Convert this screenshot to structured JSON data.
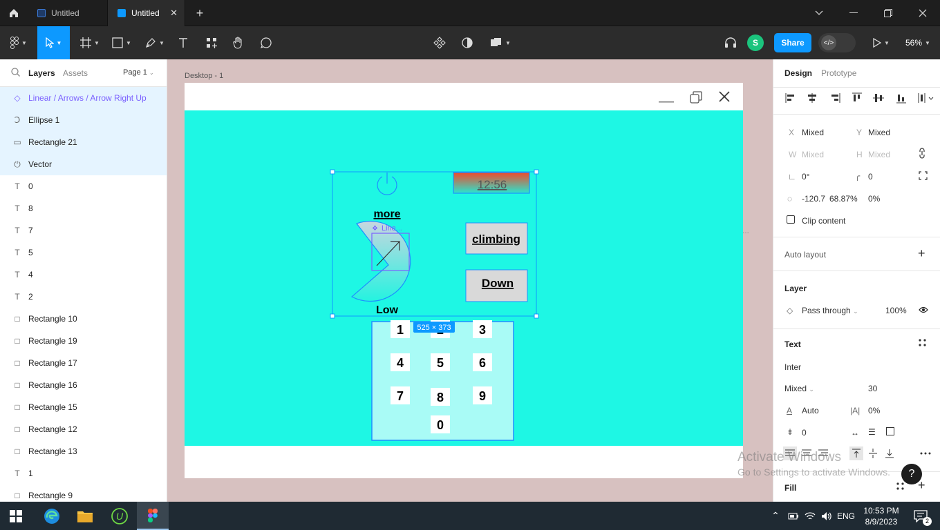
{
  "tabs": [
    {
      "label": "Untitled",
      "active": false
    },
    {
      "label": "Untitled",
      "active": true
    }
  ],
  "toolbar": {
    "share_label": "Share",
    "avatar_initial": "S",
    "zoom": "56%"
  },
  "left_panel": {
    "tab_layers": "Layers",
    "tab_assets": "Assets",
    "page": "Page 1",
    "layers": [
      {
        "icon": "component-icon",
        "glyph": "◇",
        "label": "Linear / Arrows / Arrow Right Up",
        "selected": true,
        "component": true
      },
      {
        "icon": "ellipse-icon",
        "glyph": "Ↄ",
        "label": "Ellipse 1",
        "selected": true,
        "component": false
      },
      {
        "icon": "rectangle-icon",
        "glyph": "▭",
        "label": "Rectangle 21",
        "selected": true,
        "component": false
      },
      {
        "icon": "vector-icon",
        "glyph": "⏻",
        "label": "Vector",
        "selected": true,
        "component": false
      },
      {
        "icon": "text-icon",
        "glyph": "T",
        "label": "0",
        "selected": false,
        "component": false
      },
      {
        "icon": "text-icon",
        "glyph": "T",
        "label": "8",
        "selected": false,
        "component": false
      },
      {
        "icon": "text-icon",
        "glyph": "T",
        "label": "7",
        "selected": false,
        "component": false
      },
      {
        "icon": "text-icon",
        "glyph": "T",
        "label": "5",
        "selected": false,
        "component": false
      },
      {
        "icon": "text-icon",
        "glyph": "T",
        "label": "4",
        "selected": false,
        "component": false
      },
      {
        "icon": "text-icon",
        "glyph": "T",
        "label": "2",
        "selected": false,
        "component": false
      },
      {
        "icon": "rectangle-icon",
        "glyph": "□",
        "label": "Rectangle 10",
        "selected": false,
        "component": false
      },
      {
        "icon": "rectangle-icon",
        "glyph": "□",
        "label": "Rectangle 19",
        "selected": false,
        "component": false
      },
      {
        "icon": "rectangle-icon",
        "glyph": "□",
        "label": "Rectangle 17",
        "selected": false,
        "component": false
      },
      {
        "icon": "rectangle-icon",
        "glyph": "□",
        "label": "Rectangle 16",
        "selected": false,
        "component": false
      },
      {
        "icon": "rectangle-icon",
        "glyph": "□",
        "label": "Rectangle 15",
        "selected": false,
        "component": false
      },
      {
        "icon": "rectangle-icon",
        "glyph": "□",
        "label": "Rectangle 12",
        "selected": false,
        "component": false
      },
      {
        "icon": "rectangle-icon",
        "glyph": "□",
        "label": "Rectangle 13",
        "selected": false,
        "component": false
      },
      {
        "icon": "text-icon",
        "glyph": "T",
        "label": "1",
        "selected": false,
        "component": false
      },
      {
        "icon": "rectangle-icon",
        "glyph": "□",
        "label": "Rectangle 9",
        "selected": false,
        "component": false
      }
    ]
  },
  "canvas": {
    "frame_label": "Desktop - 1",
    "time": "12:56",
    "more": "more",
    "component_tag": "Line...",
    "low": "Low",
    "climbing": "climbing",
    "down": "Down",
    "size_badge": "525 × 373",
    "keys": [
      "1",
      "2",
      "3",
      "4",
      "5",
      "6",
      "7",
      "8",
      "9",
      "0"
    ]
  },
  "right_panel": {
    "tab_design": "Design",
    "tab_prototype": "Prototype",
    "x_label": "X",
    "x_value": "Mixed",
    "y_label": "Y",
    "y_value": "Mixed",
    "w_label": "W",
    "w_value": "Mixed",
    "h_label": "H",
    "h_value": "Mixed",
    "rotation": "0°",
    "radius": "0",
    "arc_start": "-120.7",
    "arc_sweep": "68.87%",
    "arc_ratio": "0%",
    "clip_content": "Clip content",
    "auto_layout": "Auto layout",
    "layer_title": "Layer",
    "blend": "Pass through",
    "opacity": "100%",
    "text_title": "Text",
    "font": "Inter",
    "weight": "Mixed",
    "size": "30",
    "line_height": "Auto",
    "letter_spacing": "0%",
    "paragraph_spacing": "0",
    "fill_title": "Fill"
  },
  "watermark": {
    "line1": "Activate Windows",
    "line2": "Go to Settings to activate Windows."
  },
  "taskbar": {
    "lang": "ENG",
    "time": "10:53 PM",
    "date": "8/9/2023",
    "notifications": "2"
  },
  "colors": {
    "accent": "#0d99ff",
    "canvas_teal": "#1ef7e4",
    "keypad_bg": "#a9fbf6",
    "selection": "#0d99ff",
    "component": "#7b61ff"
  }
}
